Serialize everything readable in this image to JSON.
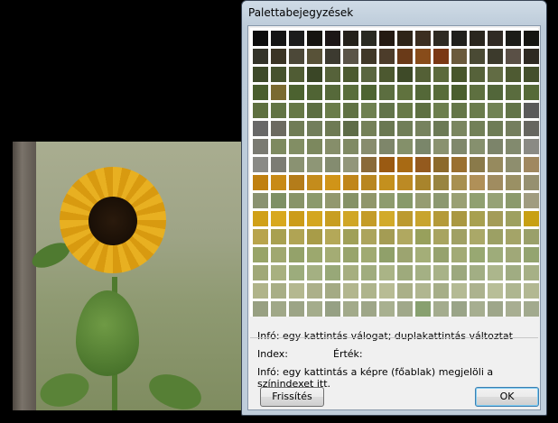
{
  "dialog": {
    "title": "Palettabejegyzések",
    "info_line1": "Infó: egy kattintás válogat; duplakattintás változtat",
    "index_label": "Index:",
    "value_label": "Érték:",
    "info_line2": "Infó: egy kattintás a képre (főablak) megjelöli a színindexet itt.",
    "refresh_button": "Frissítés",
    "ok_button": "OK"
  },
  "palette_rows": [
    [
      "#0c0c0c",
      "#141414",
      "#1c1c1c",
      "#161410",
      "#1c1616",
      "#24201a",
      "#2a2a22",
      "#241a12",
      "#2e2418",
      "#3c2e20",
      "#2e2a22",
      "#20201c",
      "#2a261e",
      "#302a24",
      "#1c1c18",
      "#141410"
    ],
    [
      "#34342a",
      "#3a3424",
      "#4c4838",
      "#585238",
      "#3c3a30",
      "#5a5448",
      "#403828",
      "#4c3c2a",
      "#6a3a18",
      "#884c1a",
      "#7a3814",
      "#6a5a3c",
      "#4a4a34",
      "#3c3a2c",
      "#5a5046",
      "#2e2a22"
    ],
    [
      "#3e4a2a",
      "#46522e",
      "#505c34",
      "#3a4626",
      "#56623a",
      "#4c5a30",
      "#5a6640",
      "#4c5830",
      "#3e4a28",
      "#546036",
      "#5c6a3c",
      "#48562c",
      "#56623a",
      "#626c44",
      "#4e5a32",
      "#44502c"
    ],
    [
      "#4a5e2e",
      "#7a6a30",
      "#4c6230",
      "#506434",
      "#56693a",
      "#5a6e3c",
      "#4e6432",
      "#5c6e40",
      "#60723e",
      "#546838",
      "#586c3a",
      "#4a5e2e",
      "#5e7040",
      "#52663a",
      "#5a6c3e",
      "#566a38"
    ],
    [
      "#5e7040",
      "#627444",
      "#667846",
      "#5c6e42",
      "#6a7c4a",
      "#607244",
      "#6e8050",
      "#62744a",
      "#687a48",
      "#5e7042",
      "#6c7e4e",
      "#647648",
      "#6a7c4c",
      "#708254",
      "#627448",
      "#5a5a5a"
    ],
    [
      "#686868",
      "#6c6a60",
      "#707c56",
      "#727e5c",
      "#6e7a54",
      "#5e6c48",
      "#748058",
      "#6a7852",
      "#707e58",
      "#76825e",
      "#6c7a56",
      "#7a8660",
      "#728058",
      "#6e7c56",
      "#747e5e",
      "#666660"
    ],
    [
      "#7a7a72",
      "#7e8a60",
      "#828e64",
      "#7c885e",
      "#868e6a",
      "#808a64",
      "#888c6e",
      "#7e866a",
      "#84906a",
      "#7a866a",
      "#8a9270",
      "#80886c",
      "#86906e",
      "#7c846a",
      "#828a6e",
      "#8a8a84"
    ],
    [
      "#8a8a86",
      "#7c7c74",
      "#8a9272",
      "#8e9676",
      "#848c70",
      "#92967a",
      "#8a6a3a",
      "#9a5a12",
      "#a86a14",
      "#945a1e",
      "#8c6a2c",
      "#9a7030",
      "#8a7a4a",
      "#968a5e",
      "#8e8e6e",
      "#a08860"
    ],
    [
      "#c08010",
      "#c88a16",
      "#b47c1a",
      "#c48c1c",
      "#d09418",
      "#c0861a",
      "#b88620",
      "#c4901e",
      "#bc8a24",
      "#a8842c",
      "#988440",
      "#a89050",
      "#b09058",
      "#a08c60",
      "#9a9064",
      "#969070"
    ],
    [
      "#8a9270",
      "#7e9064",
      "#889468",
      "#8c9a6c",
      "#92986e",
      "#869266",
      "#90966a",
      "#8e9c6e",
      "#889a6a",
      "#969c72",
      "#8c9870",
      "#9aa074",
      "#90a070",
      "#96a276",
      "#8c9a6c",
      "#a09c80"
    ],
    [
      "#d0a018",
      "#d8a81e",
      "#cc9c1a",
      "#d4a620",
      "#c89e22",
      "#d0a626",
      "#c49c28",
      "#d2aa2a",
      "#bc9a30",
      "#c8a42e",
      "#b49a3a",
      "#aa9842",
      "#a8a050",
      "#a49c58",
      "#9ea060",
      "#c8a014"
    ],
    [
      "#b8a44c",
      "#a8a050",
      "#b0a454",
      "#a89c48",
      "#b4a858",
      "#a0a058",
      "#aca45c",
      "#a49c54",
      "#b0a860",
      "#98a05c",
      "#a8a460",
      "#a0a064",
      "#aaa868",
      "#9ca064",
      "#a4a468",
      "#9aa06a"
    ],
    [
      "#98a468",
      "#a0a870",
      "#94a26a",
      "#9ca86e",
      "#a4ac74",
      "#98a46c",
      "#a0aa72",
      "#90a06a",
      "#9ca470",
      "#a4ae78",
      "#96a26e",
      "#a2aa76",
      "#98a872",
      "#9eac7a",
      "#a0a878",
      "#94a470"
    ],
    [
      "#a0a878",
      "#a8b080",
      "#9cac7c",
      "#a4b082",
      "#98a878",
      "#a6ae80",
      "#a0ac7e",
      "#aab486",
      "#9eaa7c",
      "#a4b084",
      "#a8b288",
      "#9ca87e",
      "#a2ae84",
      "#acb68c",
      "#a0ac82",
      "#a6b086"
    ],
    [
      "#b0b48a",
      "#a8ae86",
      "#b4b890",
      "#acb08a",
      "#a4aa84",
      "#b2b68e",
      "#aeb48c",
      "#b8bc94",
      "#aab088",
      "#b0b690",
      "#a6ae88",
      "#b4ba94",
      "#acb28e",
      "#b8be98",
      "#aeb690",
      "#b2b892"
    ],
    [
      "#98a082",
      "#a0a888",
      "#9ca486",
      "#a4ac8c",
      "#96a084",
      "#a2aa8a",
      "#9ea688",
      "#a8b090",
      "#a0a88a",
      "#88a070",
      "#a4ac8e",
      "#9aa488",
      "#a6ae90",
      "#9ea68a",
      "#a8ae92",
      "#a2aa8e"
    ]
  ]
}
